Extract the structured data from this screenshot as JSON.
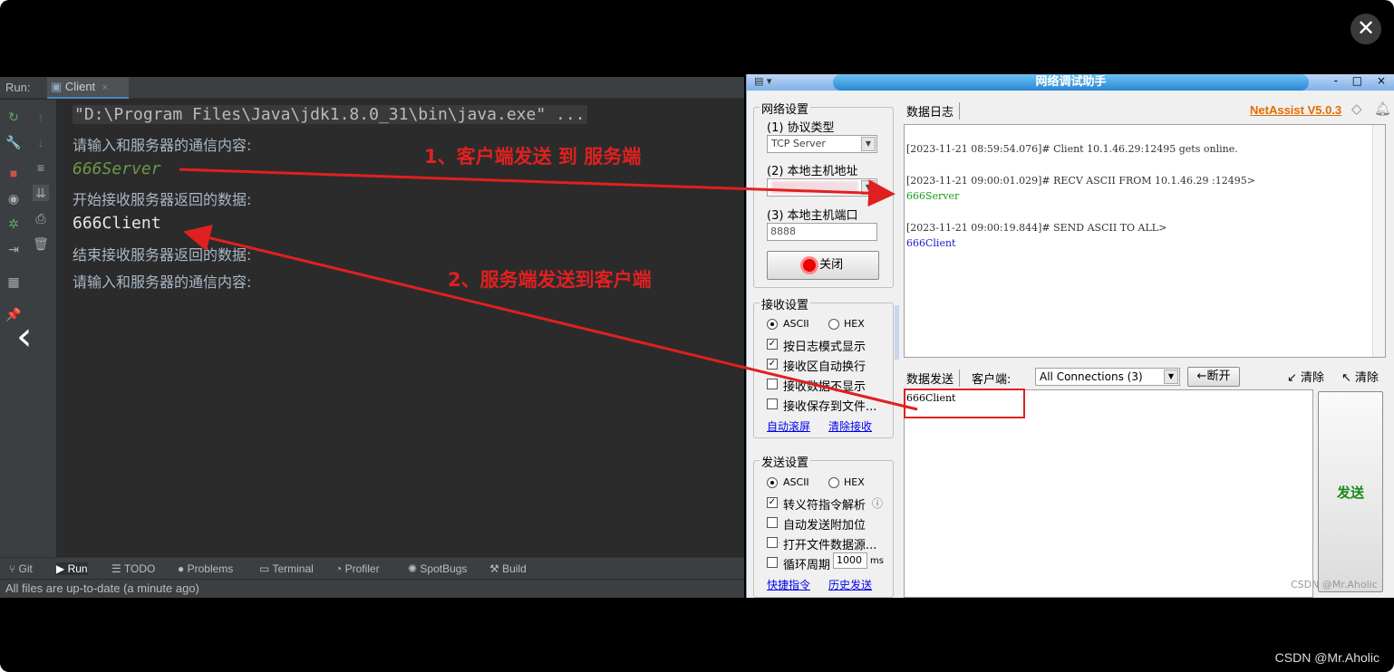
{
  "viewer": {
    "close_label": "✕",
    "prev_label": "‹",
    "watermark": "CSDN @Mr.Aholic"
  },
  "ide": {
    "run_label": "Run:",
    "tab_label": "Client",
    "tab_close": "×",
    "console_lines": [
      "\"D:\\Program Files\\Java\\jdk1.8.0_31\\bin\\java.exe\" ...",
      "请输入和服务器的通信内容:",
      "666Server",
      "开始接收服务器返回的数据:",
      "666Client",
      "结束接收服务器返回的数据:",
      "请输入和服务器的通信内容:"
    ],
    "bottom_tabs": [
      "Git",
      "Run",
      "TODO",
      "Problems",
      "Terminal",
      "Profiler",
      "SpotBugs",
      "Build"
    ],
    "status": "All files are up-to-date (a minute ago)"
  },
  "annotations": {
    "step1": "1、客户端发送 到 服务端",
    "step2": "2、服务端发送到客户端"
  },
  "netassist": {
    "title": "网络调试助手",
    "window_controls": "- □ ×",
    "net_group": "网络设置",
    "protocol_label": "(1) 协议类型",
    "protocol_value": "TCP Server",
    "host_label": "(2) 本地主机地址",
    "port_label": "(3) 本地主机端口",
    "port_value": "8888",
    "close_button": "关闭",
    "recv_group": "接收设置",
    "recv_ascii": "ASCII",
    "recv_hex": "HEX",
    "recv_opt1": "按日志模式显示",
    "recv_opt2": "接收区自动换行",
    "recv_opt3": "接收数据不显示",
    "recv_opt4": "接收保存到文件...",
    "auto_scroll": "自动滚屏",
    "clear_recv": "清除接收",
    "send_group": "发送设置",
    "send_ascii": "ASCII",
    "send_hex": "HEX",
    "send_opt1": "转义符指令解析",
    "send_opt2": "自动发送附加位",
    "send_opt3": "打开文件数据源...",
    "send_opt4": "循环周期",
    "cycle_value": "1000",
    "cycle_unit": "ms",
    "shortcut": "快捷指令",
    "history": "历史发送",
    "log_tab": "数据日志",
    "brand": "NetAssist V5.0.3",
    "log_lines": [
      {
        "text": "[2023-11-21 08:59:54.076]# Client 10.1.46.29:12495 gets online.",
        "color": "#333333"
      },
      {
        "text": "[2023-11-21 09:00:01.029]# RECV ASCII FROM 10.1.46.29 :12495>",
        "color": "#333333"
      },
      {
        "text": "666Server",
        "color": "#1a9a1a"
      },
      {
        "text": "[2023-11-21 09:00:19.844]# SEND ASCII TO ALL>",
        "color": "#333333"
      },
      {
        "text": "666Client",
        "color": "#1a1acc"
      }
    ],
    "send_tab": "数据发送",
    "client_label": "客户端:",
    "connections": "All Connections (3)",
    "disconnect": "断开",
    "clear1": "清除",
    "clear2": "清除",
    "send_text": "666Client",
    "send_button": "发送",
    "watermark": "CSDN @Mr.Aholic"
  }
}
